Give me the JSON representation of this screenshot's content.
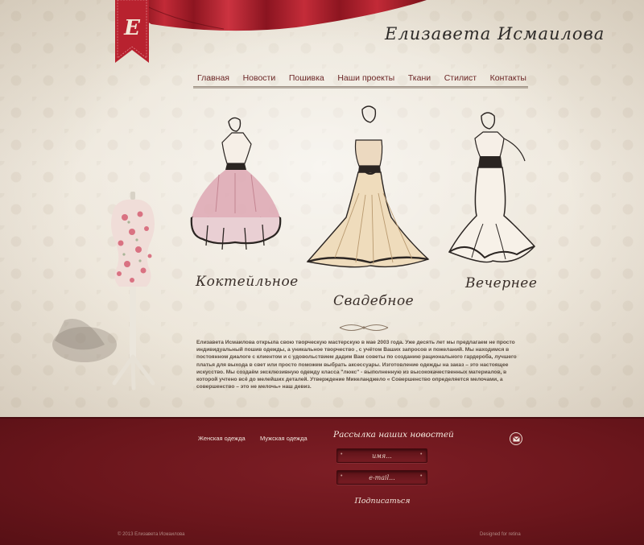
{
  "header": {
    "logo_letter": "Е",
    "site_title": "Елизавета Исмаилова"
  },
  "nav": {
    "items": [
      {
        "label": "Главная"
      },
      {
        "label": "Новости"
      },
      {
        "label": "Пошивка"
      },
      {
        "label": "Наши проекты"
      },
      {
        "label": "Ткани"
      },
      {
        "label": "Стилист"
      },
      {
        "label": "Контакты"
      }
    ]
  },
  "categories": {
    "cocktail": "Коктейльное",
    "wedding": "Свадебное",
    "evening": "Вечернее"
  },
  "about": {
    "text": "Елизавета Исмаилова открыла свою творческую мастерскую  в  мае    2003 года.   Уже десять лет мы предлагаем не просто индивидуальный пошив одежды, а уникальное творчество , с учётом Ваших запросов и пожеланий. Мы находимся в постоянном диалоге с клиентом и с удовольствием дадим Вам советы по созданию рационального гардероба, лучшего платья для выхода в свет или просто поможем выбрать аксессуары. Изготовление одежды на заказ – это настоящее искусство. Мы  создаём эксклюзивную одежду класса \"люкс\" - выполненную из высококачественных материалов, в которой учтено всё до мелейших деталей. Утверждение Микеланджело « Совершенство определяется мелочами, а совершенство  – это не мелочь» наш девиз."
  },
  "footer": {
    "link_women": "Женская одежда",
    "link_men": "Мужская одежда",
    "newsletter_title": "Рассылка наших новостей",
    "name_placeholder": "имя...",
    "email_placeholder": "e-mail...",
    "subscribe_label": "Подписаться",
    "copyright": "© 2013 Елизавета Исмаилова",
    "designed": "Designed for retina"
  },
  "colors": {
    "footer_bg": "#6b161c",
    "nav_text": "#6b2626",
    "curtain": "#a41f2c",
    "paper": "#ece6da"
  }
}
